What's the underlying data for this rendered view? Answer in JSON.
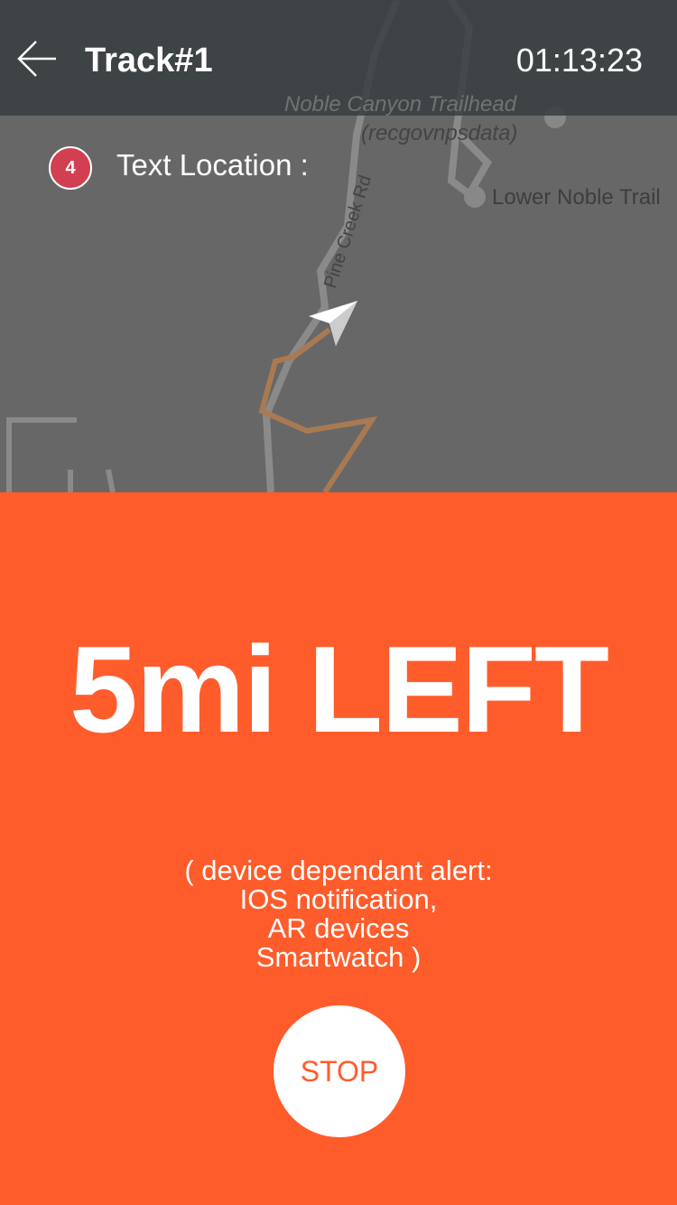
{
  "header": {
    "title": "Track#1",
    "timer": "01:13:23"
  },
  "map": {
    "labels": {
      "trailhead": "Noble Canyon Trailhead",
      "source": "(recgovnpsdata)",
      "road": "Pine Creek Rd",
      "trail": "Lower Noble Trail"
    },
    "track_color": "#a97a52"
  },
  "location": {
    "badge": "4",
    "label": "Text Location :"
  },
  "alert": {
    "headline": "5mi LEFT",
    "lines": [
      "( device dependant alert:",
      "IOS notification,",
      "AR devices",
      "Smartwatch )"
    ],
    "stop_label": "STOP"
  },
  "colors": {
    "accent": "#ff5c2b",
    "badge": "#d13f50",
    "header": "#3f4749"
  }
}
